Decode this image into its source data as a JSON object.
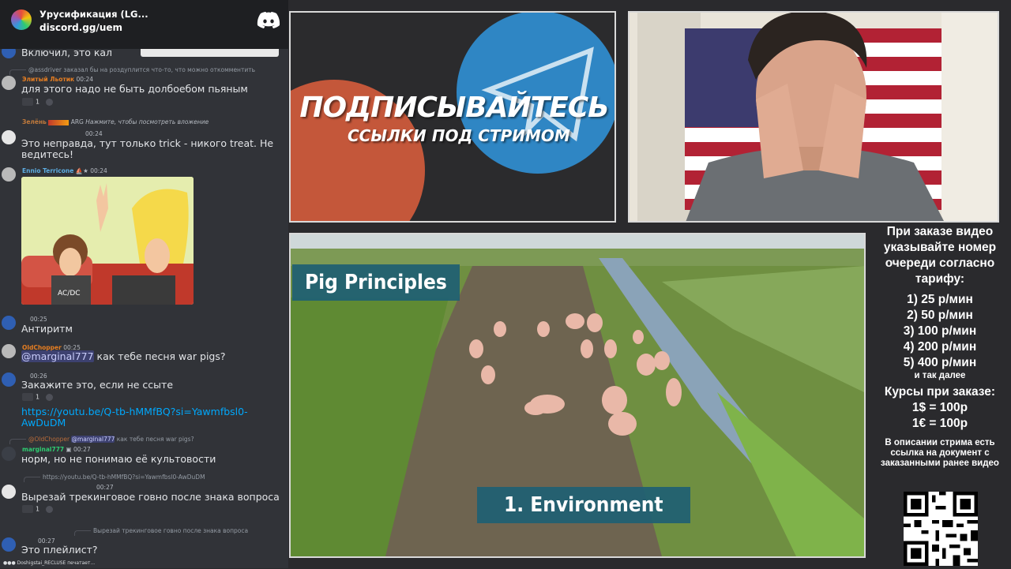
{
  "invite": {
    "title": "Урусификация (LG...",
    "url": "discord.gg/uem"
  },
  "chat": {
    "top_line": "Включил, это кал",
    "m1": {
      "reply": "заказал бы на роздуплится что-то, что можно откомментить",
      "reply_user": "@assdriver",
      "nick": "Элитый Льотик",
      "time": "00:24",
      "text": "для этого надо не быть долбоебом пьяным",
      "count": "1"
    },
    "m2": {
      "nick": "Зелёнь",
      "badge": "ARG",
      "reply": "Нажмите, чтобы посмотреть вложение",
      "time": "00:24",
      "text": "Это неправда, тут только trick - никого treat. Не ведитесь!"
    },
    "m3": {
      "nick": "Ennio Terricone",
      "time": "00:24",
      "img_text": "AC/DC"
    },
    "m4": {
      "time": "00:25",
      "text": "Антиритм"
    },
    "m5": {
      "nick": "OldChopper",
      "time": "00:25",
      "mention": "@marginal777",
      "text": " как тебе песня war pigs?"
    },
    "m6": {
      "time": "00:26",
      "text": "Закажите это, если не ссыте",
      "count": "1",
      "link": "https://youtu.be/Q-tb-hMMfBQ?si=Yawmfbsl0-AwDuDM"
    },
    "m7": {
      "reply_user": "@OldChopper",
      "reply_mention": "@marginal777",
      "reply": " как тебе песня war pigs?",
      "nick": "marginal777",
      "time": "00:27",
      "text": "норм, но не понимаю её культовости"
    },
    "m8": {
      "reply": "https://youtu.be/Q-tb-hMMfBQ?si=Yawmfbsl0-AwDuDM",
      "time": "00:27",
      "text": "Вырезай трекинговое говно после знака вопроса",
      "count": "1"
    },
    "m9": {
      "reply": "Вырезай трекинговое говно после знака вопроса",
      "time": "00:27",
      "text": "Это плейлист?"
    },
    "typing": "Doshigstai_RECLUSE печатает..."
  },
  "promo": {
    "title": "ПОДПИСЫВАЙТЕСЬ",
    "subtitle": "ССЫЛКИ ПОД СТРИМОМ"
  },
  "video": {
    "tag1": "Pig Principles",
    "tag2": "1. Environment"
  },
  "info": {
    "intro": "При заказе видео указывайте номер очереди согласно тарифу:",
    "tariffs": [
      "1) 25 р/мин",
      "2) 50 р/мин",
      "3) 100 р/мин",
      "4) 200 р/мин",
      "5) 400 р/мин"
    ],
    "etc": "и так далее",
    "courses_title": "Курсы при заказе:",
    "rate1": "1$ = 100р",
    "rate2": "1€ = 100р",
    "note": "В описании стрима есть ссылка на документ с заказанными ранее видео"
  },
  "colors": {
    "chat_bg": "#313338",
    "link": "#00a8fc",
    "tag_bg": "#1e5f73",
    "promo_red": "#c4573a",
    "promo_blue": "#2f86c4"
  }
}
